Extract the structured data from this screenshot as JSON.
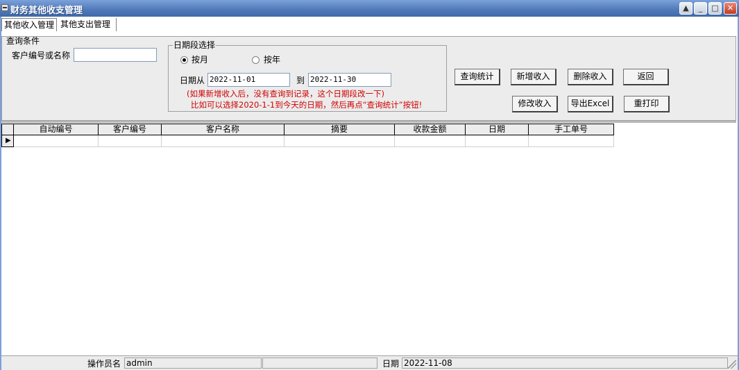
{
  "window": {
    "title": "财务其他收支管理"
  },
  "tabs": [
    {
      "label": "其他收入管理",
      "active": true
    },
    {
      "label": "其他支出管理",
      "active": false
    }
  ],
  "query": {
    "group_label": "查询条件",
    "customer_label": "客户编号或名称",
    "customer_value": "",
    "date_group_label": "日期段选择",
    "by_month_label": "按月",
    "by_year_label": "按年",
    "mode_selected": "month",
    "date_from_label": "日期从",
    "date_from": "2022-11-01",
    "date_to_label": "到",
    "date_to": "2022-11-30",
    "note1": "(如果新增收入后，没有查询到记录，这个日期段改一下)",
    "note2": "比如可以选择2020-1-1到今天的日期，然后再点“查询统计”按钮!"
  },
  "buttons": {
    "query": "查询统计",
    "add": "新增收入",
    "delete": "删除收入",
    "back": "返回",
    "edit": "修改收入",
    "export": "导出Excel",
    "reprint": "重打印"
  },
  "table": {
    "columns": [
      "自动编号",
      "客户编号",
      "客户名称",
      "摘要",
      "收款金额",
      "日期",
      "手工单号"
    ],
    "row_indicator": "▶",
    "rows": [
      [
        "",
        "",
        "",
        "",
        "",
        "",
        ""
      ]
    ]
  },
  "status": {
    "operator_label": "操作员名",
    "operator_value": "admin",
    "date_label": "日期",
    "date_value": "2022-11-08"
  },
  "colors": {
    "title_bar": "#4f78b8",
    "note_red": "#d00000"
  }
}
